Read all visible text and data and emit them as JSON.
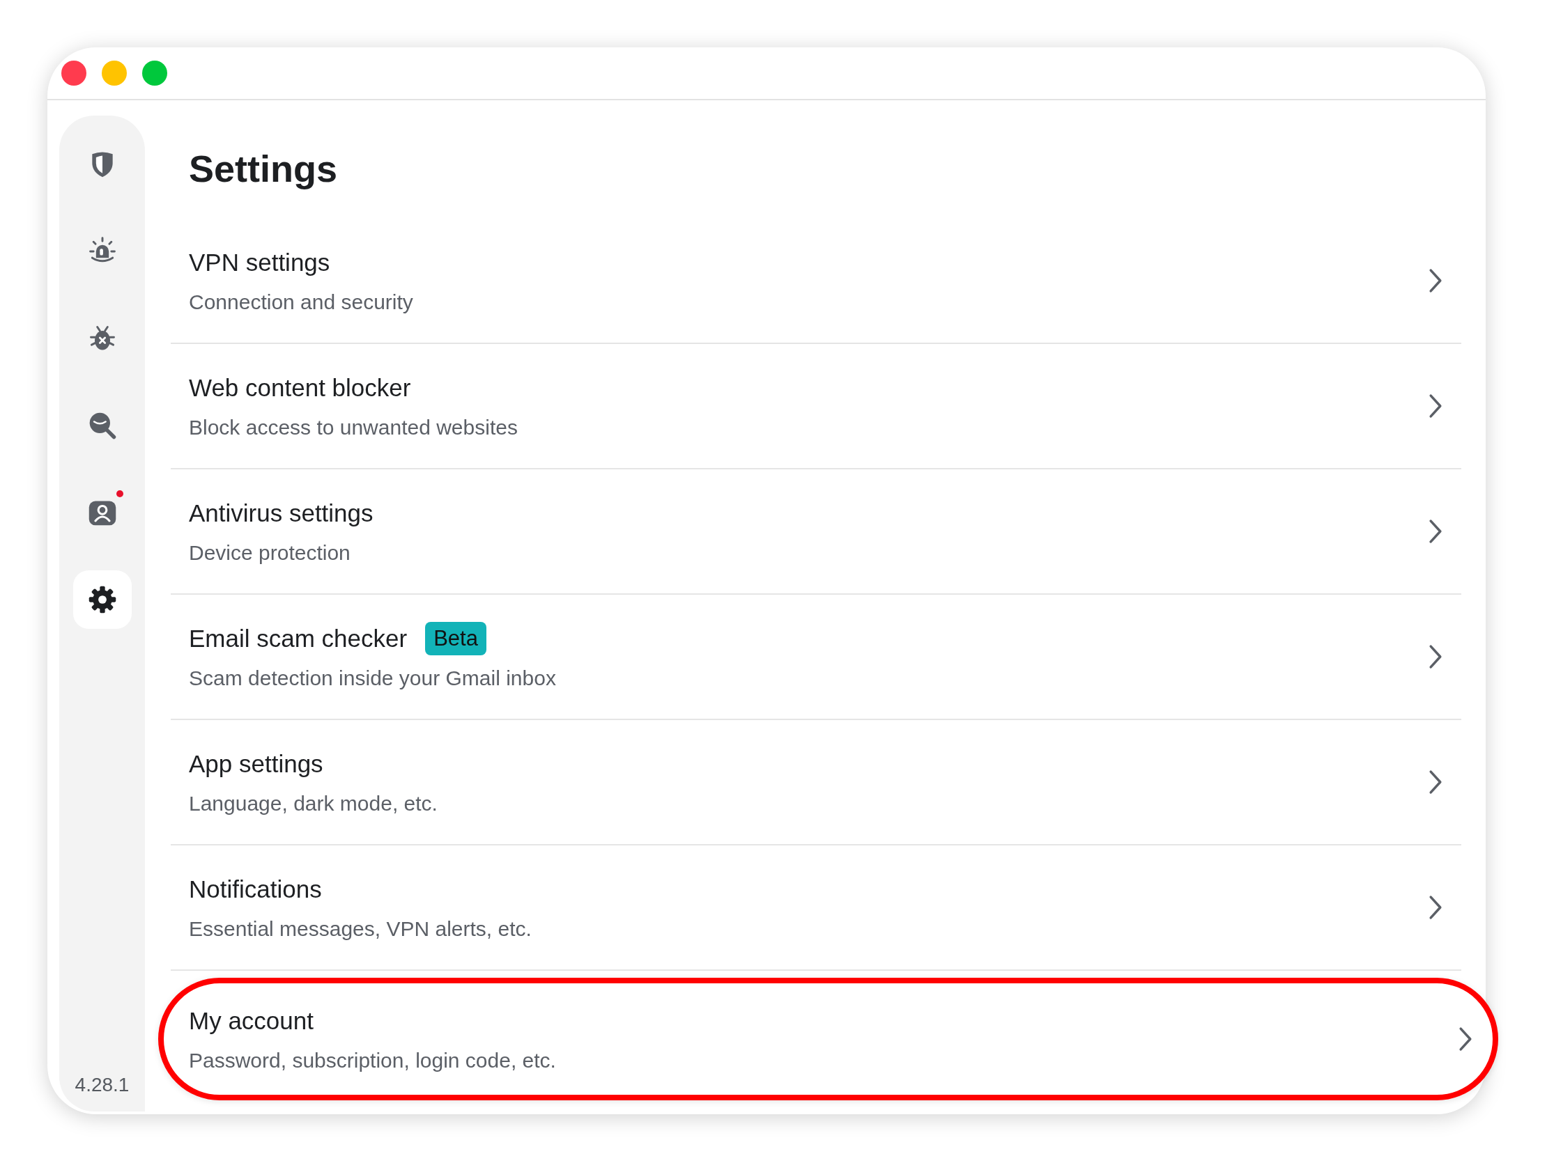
{
  "sidebar": {
    "items": [
      {
        "selected": false,
        "badge": false
      },
      {
        "selected": false,
        "badge": false
      },
      {
        "selected": false,
        "badge": false
      },
      {
        "selected": false,
        "badge": false
      },
      {
        "selected": false,
        "badge": true
      },
      {
        "selected": true,
        "badge": false
      }
    ],
    "version": "4.28.1"
  },
  "title": "Settings",
  "rows": [
    {
      "title": "VPN settings",
      "subtitle": "Connection and security",
      "highlighted": false
    },
    {
      "title": "Web content blocker",
      "subtitle": "Block access to unwanted websites",
      "highlighted": false
    },
    {
      "title": "Antivirus settings",
      "subtitle": "Device protection",
      "highlighted": false
    },
    {
      "title": "Email scam checker",
      "badge": "Beta",
      "subtitle": "Scam detection inside your Gmail inbox",
      "highlighted": false
    },
    {
      "title": "App settings",
      "subtitle": "Language, dark mode, etc.",
      "highlighted": false
    },
    {
      "title": "Notifications",
      "subtitle": "Essential messages, VPN alerts, etc.",
      "highlighted": false
    },
    {
      "title": "My account",
      "subtitle": "Password, subscription, login code, etc.",
      "highlighted": true
    }
  ]
}
